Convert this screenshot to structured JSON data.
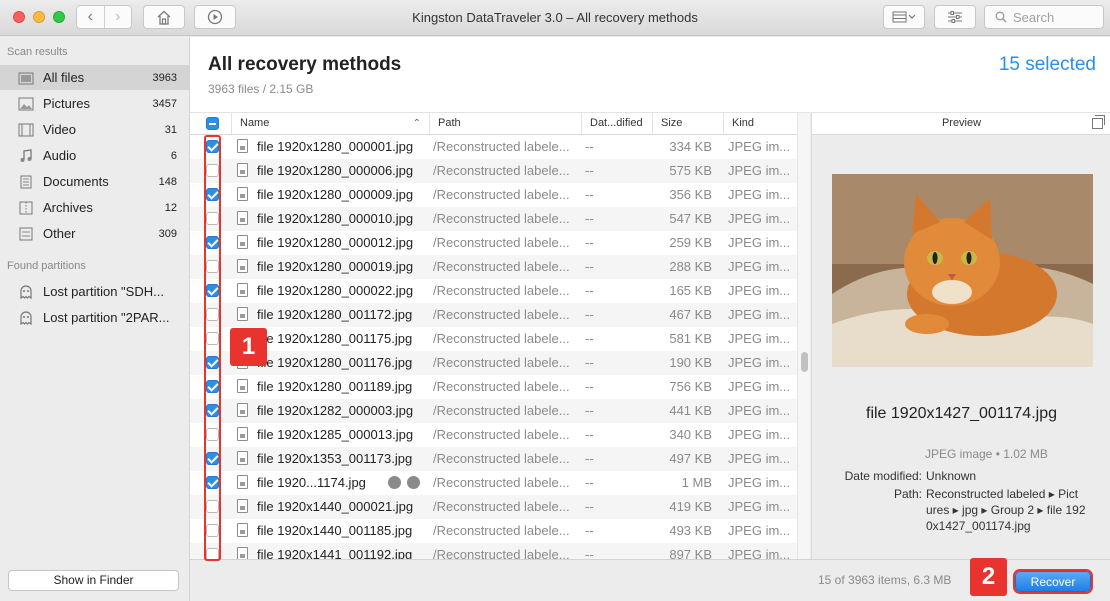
{
  "window": {
    "title": "Kingston DataTraveler 3.0 – All recovery methods",
    "search_placeholder": "Search"
  },
  "sidebar": {
    "scan_results_title": "Scan results",
    "scan_results": [
      {
        "label": "All files",
        "count": "3963",
        "icon": "stack-icon",
        "selected": true
      },
      {
        "label": "Pictures",
        "count": "3457",
        "icon": "picture-icon"
      },
      {
        "label": "Video",
        "count": "31",
        "icon": "film-icon"
      },
      {
        "label": "Audio",
        "count": "6",
        "icon": "music-note-icon"
      },
      {
        "label": "Documents",
        "count": "148",
        "icon": "document-icon"
      },
      {
        "label": "Archives",
        "count": "12",
        "icon": "archive-icon"
      },
      {
        "label": "Other",
        "count": "309",
        "icon": "other-icon"
      }
    ],
    "found_partitions_title": "Found partitions",
    "partitions": [
      {
        "label": "Lost partition \"SDH...",
        "icon": "ghost-icon"
      },
      {
        "label": "Lost partition \"2PAR...",
        "icon": "ghost-icon"
      }
    ],
    "show_in_finder": "Show in Finder"
  },
  "main": {
    "title": "All recovery methods",
    "subtitle": "3963 files / 2.15 GB",
    "selected_count": "15 selected"
  },
  "table": {
    "columns": {
      "name": "Name",
      "path": "Path",
      "date": "Dat...dified",
      "size": "Size",
      "kind": "Kind"
    },
    "rows": [
      {
        "name": "file 1920x1280_000001.jpg",
        "path": "/Reconstructed labele...",
        "date": "--",
        "size": "334 KB",
        "kind": "JPEG im...",
        "checked": true
      },
      {
        "name": "file 1920x1280_000006.jpg",
        "path": "/Reconstructed labele...",
        "date": "--",
        "size": "575 KB",
        "kind": "JPEG im...",
        "checked": false
      },
      {
        "name": "file 1920x1280_000009.jpg",
        "path": "/Reconstructed labele...",
        "date": "--",
        "size": "356 KB",
        "kind": "JPEG im...",
        "checked": true
      },
      {
        "name": "file 1920x1280_000010.jpg",
        "path": "/Reconstructed labele...",
        "date": "--",
        "size": "547 KB",
        "kind": "JPEG im...",
        "checked": false
      },
      {
        "name": "file 1920x1280_000012.jpg",
        "path": "/Reconstructed labele...",
        "date": "--",
        "size": "259 KB",
        "kind": "JPEG im...",
        "checked": true
      },
      {
        "name": "file 1920x1280_000019.jpg",
        "path": "/Reconstructed labele...",
        "date": "--",
        "size": "288 KB",
        "kind": "JPEG im...",
        "checked": false
      },
      {
        "name": "file 1920x1280_000022.jpg",
        "path": "/Reconstructed labele...",
        "date": "--",
        "size": "165 KB",
        "kind": "JPEG im...",
        "checked": true
      },
      {
        "name": "file 1920x1280_001172.jpg",
        "path": "/Reconstructed labele...",
        "date": "--",
        "size": "467 KB",
        "kind": "JPEG im...",
        "checked": false
      },
      {
        "name": "file 1920x1280_001175.jpg",
        "path": "/Reconstructed labele...",
        "date": "--",
        "size": "581 KB",
        "kind": "JPEG im...",
        "checked": false
      },
      {
        "name": "file 1920x1280_001176.jpg",
        "path": "/Reconstructed labele...",
        "date": "--",
        "size": "190 KB",
        "kind": "JPEG im...",
        "checked": true
      },
      {
        "name": "file 1920x1280_001189.jpg",
        "path": "/Reconstructed labele...",
        "date": "--",
        "size": "756 KB",
        "kind": "JPEG im...",
        "checked": true
      },
      {
        "name": "file 1920x1282_000003.jpg",
        "path": "/Reconstructed labele...",
        "date": "--",
        "size": "441 KB",
        "kind": "JPEG im...",
        "checked": true
      },
      {
        "name": "file 1920x1285_000013.jpg",
        "path": "/Reconstructed labele...",
        "date": "--",
        "size": "340 KB",
        "kind": "JPEG im...",
        "checked": false
      },
      {
        "name": "file 1920x1353_001173.jpg",
        "path": "/Reconstructed labele...",
        "date": "--",
        "size": "497 KB",
        "kind": "JPEG im...",
        "checked": true
      },
      {
        "name": "file 1920...1174.jpg",
        "path": "/Reconstructed labele...",
        "date": "--",
        "size": "1 MB",
        "kind": "JPEG im...",
        "checked": true,
        "actions": true
      },
      {
        "name": "file 1920x1440_000021.jpg",
        "path": "/Reconstructed labele...",
        "date": "--",
        "size": "419 KB",
        "kind": "JPEG im...",
        "checked": false
      },
      {
        "name": "file 1920x1440_001185.jpg",
        "path": "/Reconstructed labele...",
        "date": "--",
        "size": "493 KB",
        "kind": "JPEG im...",
        "checked": false
      },
      {
        "name": "file 1920x1441_001192.jpg",
        "path": "/Reconstructed labele...",
        "date": "--",
        "size": "897 KB",
        "kind": "JPEG im...",
        "checked": false
      }
    ]
  },
  "preview": {
    "header": "Preview",
    "filename": "file 1920x1427_001174.jpg",
    "kind": "JPEG image • 1.02 MB",
    "date_label": "Date modified:",
    "date_value": "Unknown",
    "path_label": "Path:",
    "path_lines": [
      "Reconstructed labeled ▸ Pict",
      "ures ▸ jpg ▸ Group 2 ▸ file 192",
      "0x1427_001174.jpg"
    ]
  },
  "footer": {
    "status": "15 of 3963 items, 6.3 MB",
    "recover_label": "Recover"
  },
  "annotations": {
    "badge1": "1",
    "badge2": "2"
  },
  "colors": {
    "accent": "#2d8ee9",
    "annotation": "#e8332f"
  }
}
